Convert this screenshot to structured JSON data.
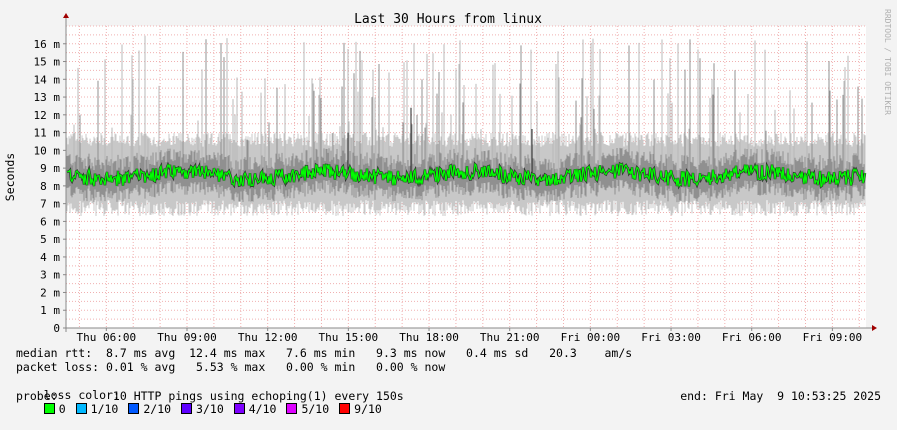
{
  "chart_data": {
    "type": "line",
    "title": "Last 30 Hours from linux",
    "ylabel": "Seconds",
    "xlabel": "",
    "ylim": [
      0,
      17
    ],
    "yticks": [
      "0",
      "1 m",
      "2 m",
      "3 m",
      "4 m",
      "5 m",
      "6 m",
      "7 m",
      "8 m",
      "9 m",
      "10 m",
      "11 m",
      "12 m",
      "13 m",
      "14 m",
      "15 m",
      "16 m"
    ],
    "xticks": [
      "Thu 06:00",
      "Thu 09:00",
      "Thu 12:00",
      "Thu 15:00",
      "Thu 18:00",
      "Thu 21:00",
      "Fri 00:00",
      "Fri 03:00",
      "Fri 06:00",
      "Fri 09:00"
    ],
    "x_hours_range": [
      4.5,
      34.25
    ],
    "xtick_hours": [
      6,
      9,
      12,
      15,
      18,
      21,
      24,
      27,
      30,
      33
    ],
    "series": [
      {
        "name": "median rtt",
        "color": "#00ff00",
        "typical_ms": 8.7,
        "min_ms": 7.6,
        "max_ms": 12.4
      },
      {
        "name": "smoke",
        "color": "#808080",
        "typical_range_ms": [
          6.5,
          10.5
        ],
        "spikes_to_ms": 16.5
      }
    ],
    "grid": true,
    "watermark": "RRDTOOL / TOBI OETIKER"
  },
  "legend": {
    "median_rtt": "median rtt:  8.7 ms avg  12.4 ms max   7.6 ms min   9.3 ms now   0.4 ms sd   20.3    am/s",
    "packet_loss": "packet loss: 0.01 % avg   5.53 % max   0.00 % min   0.00 % now",
    "loss_color_label": "loss color:",
    "loss_colors": [
      {
        "label": "0",
        "color": "#00ff00"
      },
      {
        "label": "1/10",
        "color": "#00b8ff"
      },
      {
        "label": "2/10",
        "color": "#0059ff"
      },
      {
        "label": "3/10",
        "color": "#5e00ff"
      },
      {
        "label": "4/10",
        "color": "#7e00ff"
      },
      {
        "label": "5/10",
        "color": "#dd00ff"
      },
      {
        "label": "9/10",
        "color": "#ff0000"
      }
    ],
    "probe": "probe:        10 HTTP pings using echoping(1) every 150s",
    "end": "end: Fri May  9 10:53:25 2025"
  }
}
